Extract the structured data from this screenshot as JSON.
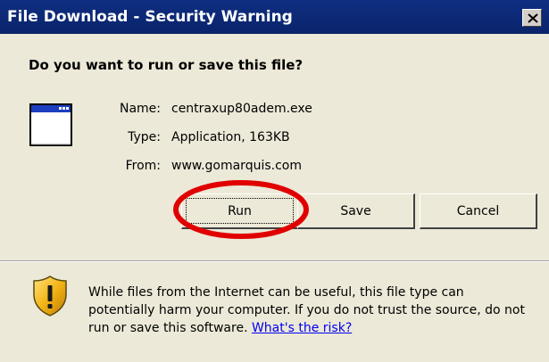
{
  "window": {
    "title": "File Download - Security Warning",
    "close_label": "×"
  },
  "dialog": {
    "question": "Do you want to run or save this file?",
    "file_icon": "application-window-icon",
    "fields": [
      {
        "label": "Name:",
        "value": "centraxup80adem.exe"
      },
      {
        "label": "Type:",
        "value": "Application, 163KB"
      },
      {
        "label": "From:",
        "value": "www.gomarquis.com"
      }
    ],
    "buttons": {
      "run": "Run",
      "save": "Save",
      "cancel": "Cancel"
    },
    "highlight_color": "#e00000",
    "warning": {
      "icon": "shield-warning-icon",
      "text": "While files from the Internet can be useful, this file type can potentially harm your computer. If you do not trust the source, do not run or save this software.",
      "link_text": "What's the risk?"
    }
  }
}
